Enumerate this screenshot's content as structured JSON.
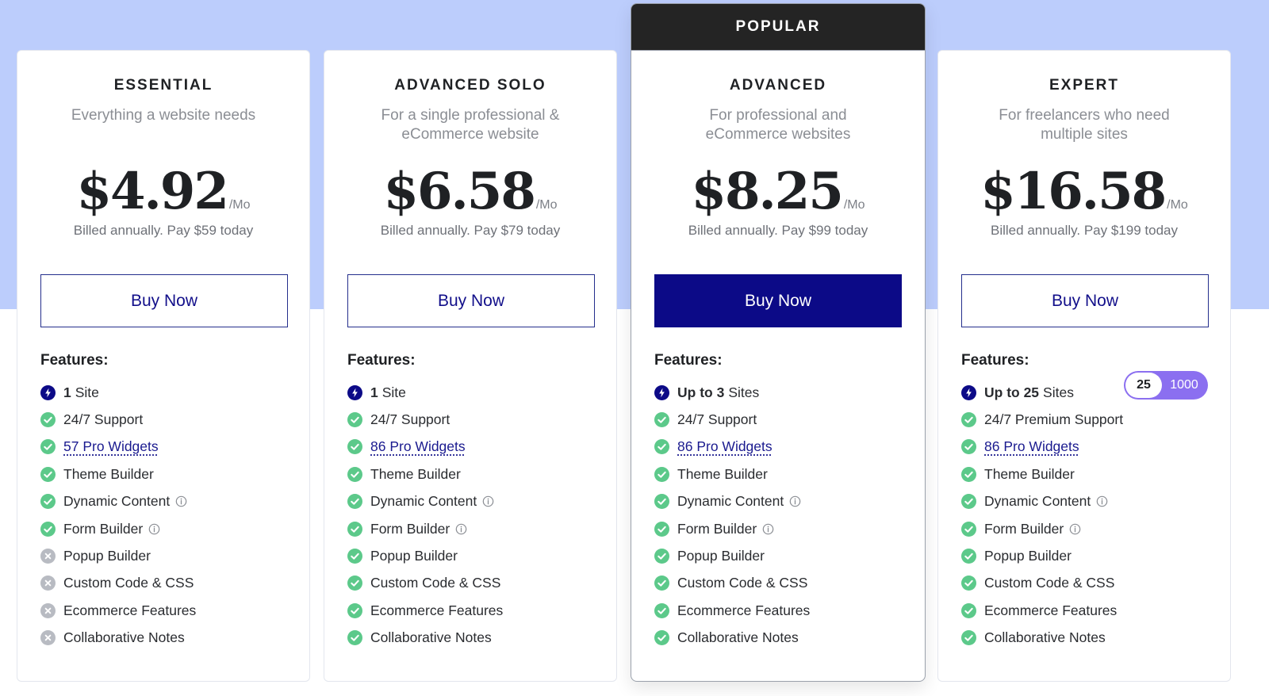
{
  "popular_badge": "POPULAR",
  "features_heading": "Features:",
  "per_label": "/Mo",
  "buy_label": "Buy Now",
  "colors": {
    "band": "#bccdfc",
    "accent": "#0c0a87",
    "check": "#5cc98a",
    "cross": "#b8bbc2",
    "toggle": "#8b6ff0"
  },
  "icons": {
    "sites": "bolt-icon",
    "included": "check-circle-icon",
    "excluded": "x-circle-icon",
    "info": "info-icon"
  },
  "plans": [
    {
      "name": "ESSENTIAL",
      "desc": "Everything a website needs",
      "price": "$4.92",
      "billed": "Billed annually. Pay $59 today",
      "features": [
        {
          "strong": "1",
          "text": "Site",
          "icon": "bolt"
        },
        {
          "text": "24/7 Support",
          "icon": "check"
        },
        {
          "text": "57 Pro Widgets",
          "icon": "check",
          "link": true
        },
        {
          "text": "Theme Builder",
          "icon": "check"
        },
        {
          "text": "Dynamic Content",
          "icon": "check",
          "info": true
        },
        {
          "text": "Form Builder",
          "icon": "check",
          "info": true
        },
        {
          "text": "Popup Builder",
          "icon": "cross"
        },
        {
          "text": "Custom Code & CSS",
          "icon": "cross"
        },
        {
          "text": "Ecommerce Features",
          "icon": "cross"
        },
        {
          "text": "Collaborative Notes",
          "icon": "cross"
        }
      ]
    },
    {
      "name": "ADVANCED SOLO",
      "desc": "For a single professional & eCommerce website",
      "price": "$6.58",
      "billed": "Billed annually. Pay $79 today",
      "features": [
        {
          "strong": "1",
          "text": "Site",
          "icon": "bolt"
        },
        {
          "text": "24/7 Support",
          "icon": "check"
        },
        {
          "text": "86 Pro Widgets",
          "icon": "check",
          "link": true
        },
        {
          "text": "Theme Builder",
          "icon": "check"
        },
        {
          "text": "Dynamic Content",
          "icon": "check",
          "info": true
        },
        {
          "text": "Form Builder",
          "icon": "check",
          "info": true
        },
        {
          "text": "Popup Builder",
          "icon": "check"
        },
        {
          "text": "Custom Code & CSS",
          "icon": "check"
        },
        {
          "text": "Ecommerce Features",
          "icon": "check"
        },
        {
          "text": "Collaborative Notes",
          "icon": "check"
        }
      ]
    },
    {
      "name": "ADVANCED",
      "desc": "For professional and eCommerce websites",
      "price": "$8.25",
      "billed": "Billed annually. Pay $99 today",
      "popular": true,
      "features": [
        {
          "strong": "Up to 3",
          "text": "Sites",
          "icon": "bolt"
        },
        {
          "text": "24/7 Support",
          "icon": "check"
        },
        {
          "text": "86 Pro Widgets",
          "icon": "check",
          "link": true
        },
        {
          "text": "Theme Builder",
          "icon": "check"
        },
        {
          "text": "Dynamic Content",
          "icon": "check",
          "info": true
        },
        {
          "text": "Form Builder",
          "icon": "check",
          "info": true
        },
        {
          "text": "Popup Builder",
          "icon": "check"
        },
        {
          "text": "Custom Code & CSS",
          "icon": "check"
        },
        {
          "text": "Ecommerce Features",
          "icon": "check"
        },
        {
          "text": "Collaborative Notes",
          "icon": "check"
        }
      ]
    },
    {
      "name": "EXPERT",
      "desc": "For freelancers who need multiple sites",
      "price": "$16.58",
      "billed": "Billed annually. Pay $199 today",
      "toggle": {
        "selected": "25",
        "other": "1000"
      },
      "features": [
        {
          "strong": "Up to 25",
          "text": "Sites",
          "icon": "bolt"
        },
        {
          "text": "24/7 Premium Support",
          "icon": "check"
        },
        {
          "text": "86 Pro Widgets",
          "icon": "check",
          "link": true
        },
        {
          "text": "Theme Builder",
          "icon": "check"
        },
        {
          "text": "Dynamic Content",
          "icon": "check",
          "info": true
        },
        {
          "text": "Form Builder",
          "icon": "check",
          "info": true
        },
        {
          "text": "Popup Builder",
          "icon": "check"
        },
        {
          "text": "Custom Code & CSS",
          "icon": "check"
        },
        {
          "text": "Ecommerce Features",
          "icon": "check"
        },
        {
          "text": "Collaborative Notes",
          "icon": "check"
        }
      ]
    }
  ]
}
